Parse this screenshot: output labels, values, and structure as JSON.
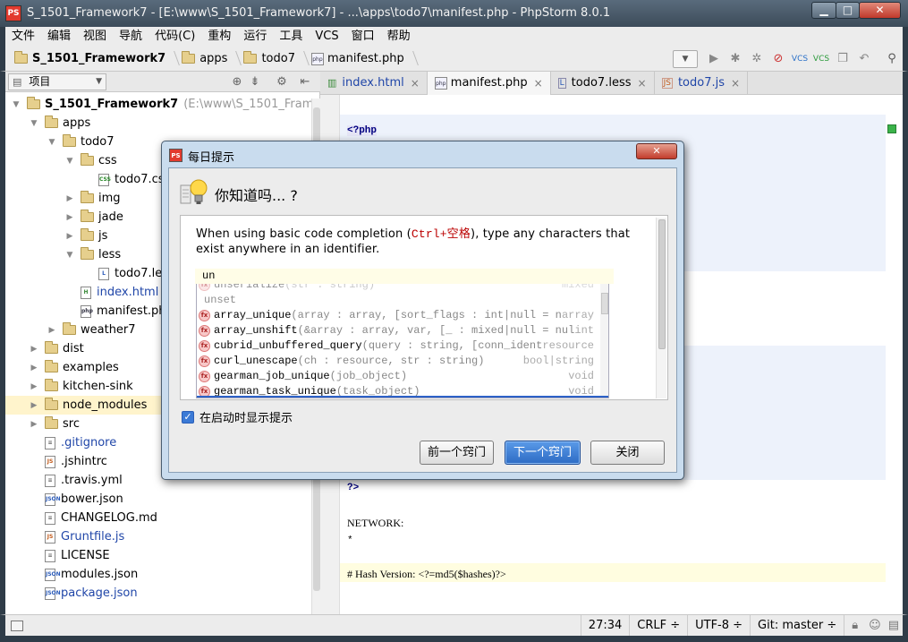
{
  "window": {
    "app_icon_text": "PS",
    "title": "S_1501_Framework7 - [E:\\www\\S_1501_Framework7] - ...\\apps\\todo7\\manifest.php - PhpStorm 8.0.1",
    "min_glyph": "▁",
    "max_glyph": "□",
    "close_glyph": "✕"
  },
  "menu": [
    "文件",
    "编辑",
    "视图",
    "导航",
    "代码(C)",
    "重构",
    "运行",
    "工具",
    "VCS",
    "窗口",
    "帮助"
  ],
  "breadcrumb": {
    "project": "S_1501_Framework7",
    "folder1": "apps",
    "folder2": "todo7",
    "file": "manifest.php"
  },
  "project_panel": {
    "dropdown_label": "项目",
    "tree": [
      {
        "label": "S_1501_Framework7",
        "suffix": "(E:\\www\\S_1501_Framework7)",
        "kind": "folder",
        "arrow": "▼"
      },
      {
        "label": "apps",
        "kind": "folder",
        "arrow": "▼"
      },
      {
        "label": "todo7",
        "kind": "folder",
        "arrow": "▼"
      },
      {
        "label": "css",
        "kind": "folder",
        "arrow": "▼"
      },
      {
        "label": "todo7.css",
        "kind": "css"
      },
      {
        "label": "img",
        "kind": "folder",
        "arrow": "▶"
      },
      {
        "label": "jade",
        "kind": "folder",
        "arrow": "▶"
      },
      {
        "label": "js",
        "kind": "folder",
        "arrow": "▶"
      },
      {
        "label": "less",
        "kind": "folder",
        "arrow": "▼"
      },
      {
        "label": "todo7.less",
        "kind": "less"
      },
      {
        "label": "index.html",
        "kind": "html"
      },
      {
        "label": "manifest.php",
        "kind": "php"
      },
      {
        "label": "weather7",
        "kind": "folder",
        "arrow": "▶"
      },
      {
        "label": "dist",
        "kind": "folder",
        "arrow": "▶"
      },
      {
        "label": "examples",
        "kind": "folder",
        "arrow": "▶"
      },
      {
        "label": "kitchen-sink",
        "kind": "folder",
        "arrow": "▶"
      },
      {
        "label": "node_modules",
        "kind": "folder",
        "arrow": "▶"
      },
      {
        "label": "src",
        "kind": "folder",
        "arrow": "▶"
      },
      {
        "label": ".gitignore",
        "kind": "text"
      },
      {
        "label": ".jshintrc",
        "kind": "js"
      },
      {
        "label": ".travis.yml",
        "kind": "text"
      },
      {
        "label": "bower.json",
        "kind": "json"
      },
      {
        "label": "CHANGELOG.md",
        "kind": "text"
      },
      {
        "label": "Gruntfile.js",
        "kind": "js"
      },
      {
        "label": "LICENSE",
        "kind": "text"
      },
      {
        "label": "modules.json",
        "kind": "json"
      },
      {
        "label": "package.json",
        "kind": "json"
      }
    ]
  },
  "tabs": [
    {
      "label": "index.html",
      "close": "×"
    },
    {
      "label": "manifest.php",
      "close": "×"
    },
    {
      "label": "todo7.less",
      "close": "×"
    },
    {
      "label": "todo7.js",
      "close": "×"
    }
  ],
  "editor": {
    "line_php_open": "<?php",
    "line_php_close": "?>",
    "line_network": "NETWORK:",
    "line_star": "*",
    "line_hash": "# Hash Version: <?=md5($hashes)?>"
  },
  "status": {
    "position": "27:34",
    "line_ending": "CRLF ÷",
    "encoding": "UTF-8 ÷",
    "vcs_branch": "Git: master ÷"
  },
  "dialog": {
    "title": "每日提示",
    "close_glyph": "✕",
    "heading": "你知道吗... ?",
    "tip_before": "When using basic code completion (",
    "tip_key": "Ctrl+空格",
    "tip_after": "), type any characters that exist anywhere in an identifier.",
    "demo_input": "un",
    "completions": [
      {
        "name": "unserialize",
        "params": "(str : string)",
        "type": "mixed",
        "faded": true
      },
      {
        "name": "unset",
        "params": "",
        "type": "",
        "faded": true,
        "icon": false
      },
      {
        "name": "array_unique",
        "params": "(array : array, [sort_flags : int|null = n",
        "type": "array"
      },
      {
        "name": "array_unshift",
        "params": "(&array : array, var, [_ : mixed|null = nul",
        "type": "int"
      },
      {
        "name": "cubrid_unbuffered_query",
        "params": "(query : string, [conn_ident",
        "type": "resource"
      },
      {
        "name": "curl_unescape",
        "params": "(ch : resource, str : string)",
        "type": "bool|string"
      },
      {
        "name": "gearman_job_unique",
        "params": "(job_object)",
        "type": "void"
      },
      {
        "name": "gearman_task_unique",
        "params": "(task_object)",
        "type": "void"
      }
    ],
    "fx_label": "fx",
    "startup_checkbox": "在启动时显示提示",
    "prev_button": "前一个窍门",
    "next_button": "下一个窍门",
    "close_button": "关闭"
  }
}
